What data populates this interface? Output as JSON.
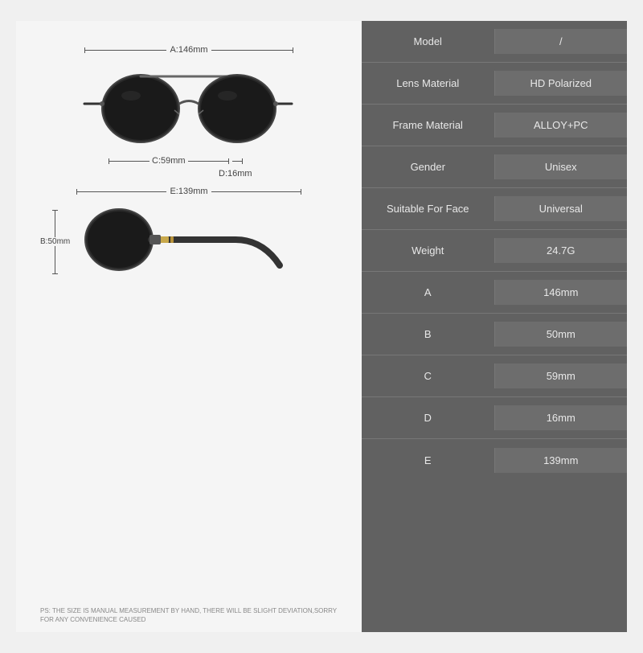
{
  "left": {
    "dimension_a_label": "A:146mm",
    "dimension_c_label": "C:59mm",
    "dimension_d_label": "D:16mm",
    "dimension_e_label": "E:139mm",
    "dimension_b_label": "B:50mm",
    "ps_note": "PS: THE SIZE IS MANUAL MEASUREMENT BY HAND, THERE WILL BE SLIGHT DEVIATION,SORRY FOR ANY CONVENIENCE CAUSED"
  },
  "specs": [
    {
      "label": "Model",
      "value": "/"
    },
    {
      "label": "Lens Material",
      "value": "HD Polarized"
    },
    {
      "label": "Frame Material",
      "value": "ALLOY+PC"
    },
    {
      "label": "Gender",
      "value": "Unisex"
    },
    {
      "label": "Suitable For Face",
      "value": "Universal"
    },
    {
      "label": "Weight",
      "value": "24.7G"
    },
    {
      "label": "A",
      "value": "146mm"
    },
    {
      "label": "B",
      "value": "50mm"
    },
    {
      "label": "C",
      "value": "59mm"
    },
    {
      "label": "D",
      "value": "16mm"
    },
    {
      "label": "E",
      "value": "139mm"
    }
  ]
}
